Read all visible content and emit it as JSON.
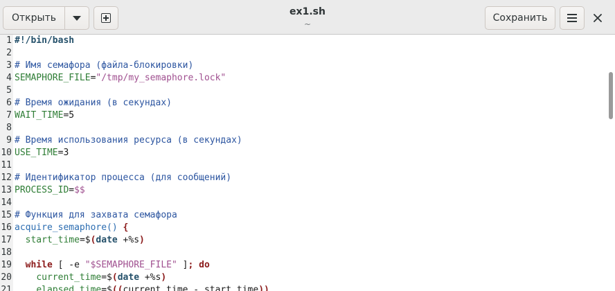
{
  "window": {
    "title": "ex1.sh",
    "subtitle": "~"
  },
  "toolbar": {
    "open_label": "Открыть",
    "open_menu_icon": "triangle-down-icon",
    "new_tab_icon": "new-tab-icon",
    "save_label": "Сохранить",
    "menu_icon": "hamburger-menu-icon",
    "close_icon": "close-icon"
  },
  "lines": [
    {
      "n": "1",
      "segs": [
        {
          "t": "#!/bin/bash",
          "c": "sheb"
        }
      ]
    },
    {
      "n": "2",
      "segs": []
    },
    {
      "n": "3",
      "segs": [
        {
          "t": "# Имя семафора (файла-блокировки)",
          "c": "cmt"
        }
      ]
    },
    {
      "n": "4",
      "segs": [
        {
          "t": "SEMAPHORE_FILE",
          "c": "var"
        },
        {
          "t": "=",
          "c": ""
        },
        {
          "t": "\"/tmp/my_semaphore.lock\"",
          "c": "str"
        }
      ]
    },
    {
      "n": "5",
      "segs": []
    },
    {
      "n": "6",
      "segs": [
        {
          "t": "# Время ожидания (в секундах)",
          "c": "cmt"
        }
      ]
    },
    {
      "n": "7",
      "segs": [
        {
          "t": "WAIT_TIME",
          "c": "var"
        },
        {
          "t": "=5",
          "c": ""
        }
      ]
    },
    {
      "n": "8",
      "segs": []
    },
    {
      "n": "9",
      "segs": [
        {
          "t": "# Время использования ресурса (в секундах)",
          "c": "cmt"
        }
      ]
    },
    {
      "n": "10",
      "segs": [
        {
          "t": "USE_TIME",
          "c": "var"
        },
        {
          "t": "=3",
          "c": ""
        }
      ]
    },
    {
      "n": "11",
      "segs": []
    },
    {
      "n": "12",
      "segs": [
        {
          "t": "# Идентификатор процесса (для сообщений)",
          "c": "cmt"
        }
      ]
    },
    {
      "n": "13",
      "segs": [
        {
          "t": "PROCESS_ID",
          "c": "var"
        },
        {
          "t": "=",
          "c": ""
        },
        {
          "t": "$$",
          "c": "str"
        }
      ]
    },
    {
      "n": "14",
      "segs": []
    },
    {
      "n": "15",
      "segs": [
        {
          "t": "# Функция для захвата семафора",
          "c": "cmt"
        }
      ]
    },
    {
      "n": "16",
      "segs": [
        {
          "t": "acquire_semaphore()",
          "c": "fn"
        },
        {
          "t": " ",
          "c": ""
        },
        {
          "t": "{",
          "c": "kw2"
        }
      ]
    },
    {
      "n": "17",
      "segs": [
        {
          "t": "  ",
          "c": ""
        },
        {
          "t": "start_time",
          "c": "var"
        },
        {
          "t": "=$",
          "c": ""
        },
        {
          "t": "(",
          "c": "kw2"
        },
        {
          "t": "date",
          "c": "kw"
        },
        {
          "t": " +%s",
          "c": ""
        },
        {
          "t": ")",
          "c": "kw2"
        }
      ]
    },
    {
      "n": "18",
      "segs": []
    },
    {
      "n": "19",
      "segs": [
        {
          "t": "  ",
          "c": ""
        },
        {
          "t": "while",
          "c": "kw2"
        },
        {
          "t": " [ -e ",
          "c": ""
        },
        {
          "t": "\"$SEMAPHORE_FILE\"",
          "c": "str"
        },
        {
          "t": " ]",
          "c": ""
        },
        {
          "t": "; do",
          "c": "kw2"
        }
      ]
    },
    {
      "n": "20",
      "segs": [
        {
          "t": "    ",
          "c": ""
        },
        {
          "t": "current_time",
          "c": "var"
        },
        {
          "t": "=$",
          "c": ""
        },
        {
          "t": "(",
          "c": "kw2"
        },
        {
          "t": "date",
          "c": "kw"
        },
        {
          "t": " +%s",
          "c": ""
        },
        {
          "t": ")",
          "c": "kw2"
        }
      ]
    },
    {
      "n": "21",
      "segs": [
        {
          "t": "    ",
          "c": ""
        },
        {
          "t": "elapsed_time",
          "c": "var"
        },
        {
          "t": "=$",
          "c": ""
        },
        {
          "t": "((",
          "c": "kw2"
        },
        {
          "t": "current_time - start_time",
          "c": ""
        },
        {
          "t": "))",
          "c": "kw2"
        }
      ]
    }
  ]
}
